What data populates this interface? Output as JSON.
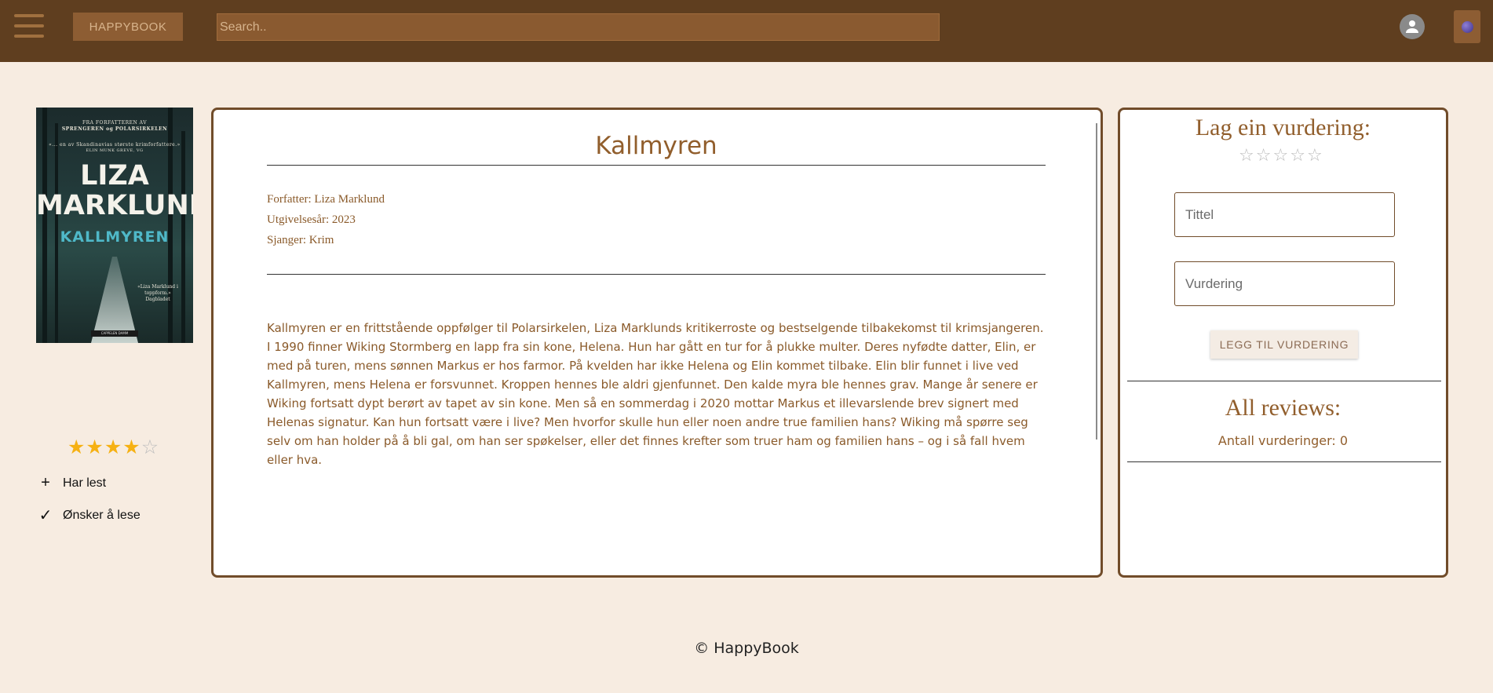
{
  "header": {
    "brand_label": "HAPPYBOOK",
    "search_placeholder": "Search..",
    "icons": {
      "menu": "hamburger-menu-icon",
      "user": "user-avatar-icon",
      "extra": "purple-orb-icon"
    }
  },
  "book": {
    "cover": {
      "tagline": "FRA FORFATTEREN AV",
      "tagline_books": "SPRENGEREN og POLARSIRKELEN",
      "blurb": "«... en av Skandinavias største krimforfattere.»",
      "blurb_source": "ELIN MUNK GREVE, VG",
      "author_line1": "LIZA",
      "author_line2": "MARKLUND",
      "title": "KALLMYREN",
      "quote": "«Liza Marklund i toppform.»",
      "quote_source": "Dagbladet",
      "publisher": "CAPPELEN DAMM"
    },
    "rating": 4,
    "rating_max": 5,
    "actions": [
      {
        "icon": "plus-icon",
        "label": "Har lest"
      },
      {
        "icon": "check-icon",
        "label": "Ønsker å lese"
      }
    ],
    "title": "Kallmyren",
    "author_line": "Forfatter: Liza Marklund",
    "year_line": "Utgivelsesår: 2023",
    "genre_line": "Sjanger: Krim",
    "description": "Kallmyren er en frittstående oppfølger til Polarsirkelen, Liza Marklunds kritikerroste og bestselgende tilbakekomst til krimsjangeren. I 1990 finner Wiking Stormberg en lapp fra sin kone, Helena. Hun har gått en tur for å plukke multer. Deres nyfødte datter, Elin, er med på turen, mens sønnen Markus er hos farmor. På kvelden har ikke Helena og Elin kommet tilbake. Elin blir funnet i live ved Kallmyren, mens Helena er forsvunnet. Kroppen hennes ble aldri gjenfunnet. Den kalde myra ble hennes grav. Mange år senere er Wiking fortsatt dypt berørt av tapet av sin kone. Men så en sommerdag i 2020 mottar Markus et illevarslende brev signert med Helenas signatur. Kan hun fortsatt være i live? Men hvorfor skulle hun eller noen andre true familien hans? Wiking må spørre seg selv om han holder på å bli gal, om han ser spøkelser, eller det finnes krefter som truer ham og familien hans – og i så fall hvem eller hva."
  },
  "review": {
    "heading": "Lag ein vurdering:",
    "star_count": 5,
    "title_placeholder": "Tittel",
    "rating_placeholder": "Vurdering",
    "submit_label": "LEGG TIL VURDERING",
    "all_heading": "All reviews:",
    "count_label": "Antall vurderinger: 0"
  },
  "footer": {
    "text": "© HappyBook"
  },
  "colors": {
    "topbar": "#5f3e1f",
    "background": "#f7ece1",
    "accent": "#915e2c",
    "star": "#f6b113"
  }
}
